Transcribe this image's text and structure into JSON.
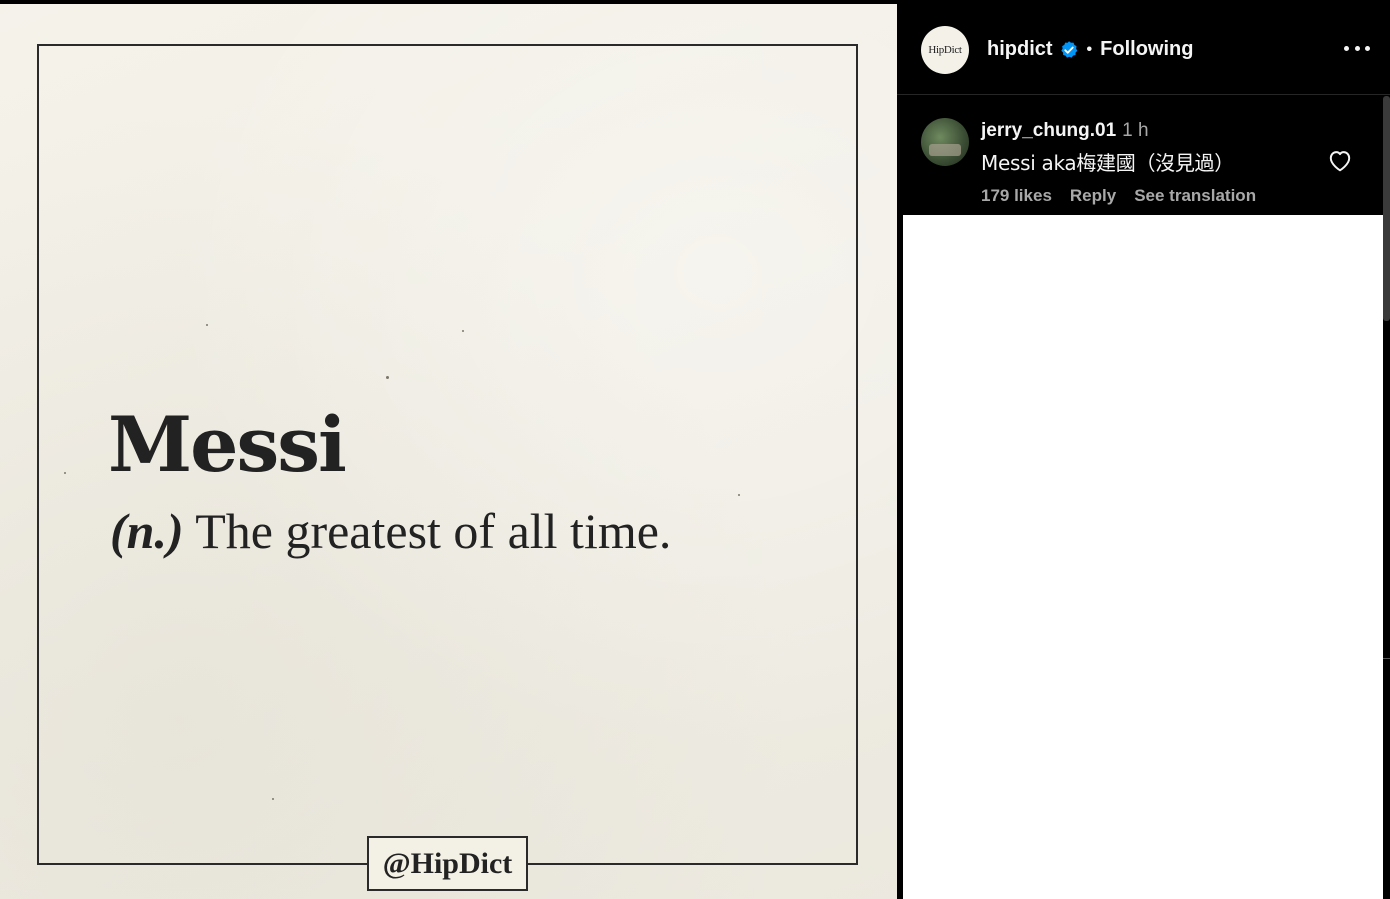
{
  "post": {
    "word": "Messi",
    "part_of_speech": "(n.)",
    "definition": "The greatest of all time.",
    "handle": "@HipDict"
  },
  "header": {
    "avatar_text": "HipDict",
    "username": "hipdict",
    "separator": "•",
    "follow_label": "Following",
    "verified_color": "#0095f6"
  },
  "comment": {
    "username": "jerry_chung.01",
    "time": "1 h",
    "text": "Messi aka梅建國（沒見過）",
    "likes": "179 likes",
    "reply_label": "Reply",
    "translation_label": "See translation"
  },
  "icons": {
    "verified": "verified-badge-icon",
    "more": "more-options-icon",
    "heart": "heart-icon"
  }
}
